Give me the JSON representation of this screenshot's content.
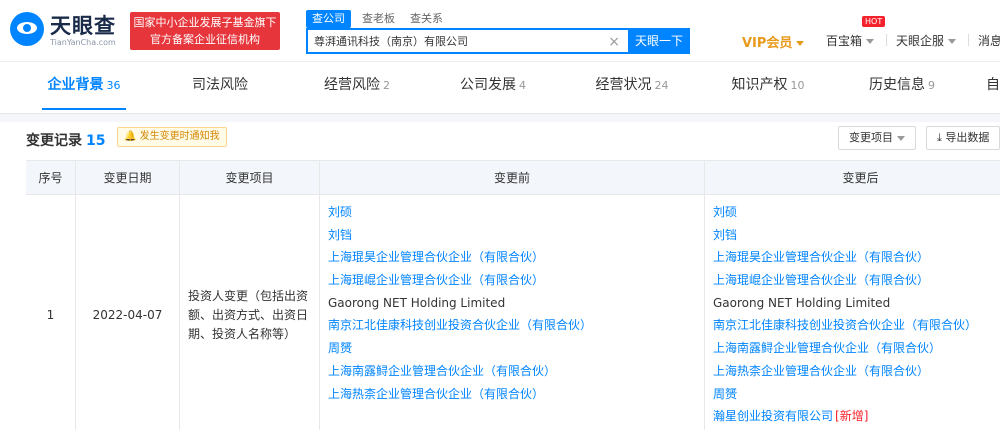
{
  "brand": {
    "name": "天眼查",
    "domain": "TianYanCha.com",
    "badge_line1": "国家中小企业发展子基金旗下",
    "badge_line2": "官方备案企业征信机构"
  },
  "search": {
    "tabs": [
      "查公司",
      "查老板",
      "查关系"
    ],
    "value": "尊湃通讯科技（南京）有限公司",
    "button": "天眼一下"
  },
  "nav": {
    "vip": "VIP会员",
    "baibaoxiang": "百宝箱",
    "hot_badge": "HOT",
    "qifu": "天眼企服",
    "messages": "消息"
  },
  "tabs": [
    {
      "label": "企业背景",
      "count": "36"
    },
    {
      "label": "司法风险",
      "count": ""
    },
    {
      "label": "经营风险",
      "count": "2"
    },
    {
      "label": "公司发展",
      "count": "4"
    },
    {
      "label": "经营状况",
      "count": "24"
    },
    {
      "label": "知识产权",
      "count": "10"
    },
    {
      "label": "历史信息",
      "count": "9"
    },
    {
      "label": "自",
      "count": ""
    }
  ],
  "section": {
    "title": "变更记录",
    "count": "15",
    "notify": "发生变更时通知我",
    "filter_button": "变更项目",
    "export_button": "导出数据"
  },
  "table": {
    "headers": [
      "序号",
      "变更日期",
      "变更项目",
      "变更前",
      "变更后"
    ],
    "rows": [
      {
        "index": "1",
        "date": "2022-04-07",
        "item": "投资人变更（包括出资额、出资方式、出资日期、投资人名称等）",
        "before": [
          "刘硕",
          "刘铛",
          "上海琨昊企业管理合伙企业（有限合伙）",
          "上海琨崐企业管理合伙企业（有限合伙）",
          "Gaorong NET Holding Limited",
          "南京江北佳康科技创业投资合伙企业（有限合伙）",
          "周赟",
          "上海南露鲟企业管理合伙企业（有限合伙）",
          "上海热柰企业管理合伙企业（有限合伙）"
        ],
        "after": [
          "刘硕",
          "刘铛",
          "上海琨昊企业管理合伙企业（有限合伙）",
          "上海琨崐企业管理合伙企业（有限合伙）",
          "Gaorong NET Holding Limited",
          "南京江北佳康科技创业投资合伙企业（有限合伙）",
          "上海南露鲟企业管理合伙企业（有限合伙）",
          "上海热柰企业管理合伙企业（有限合伙）",
          "周赟",
          "瀚星创业投资有限公司"
        ],
        "new_tag": "[新增]"
      }
    ]
  }
}
